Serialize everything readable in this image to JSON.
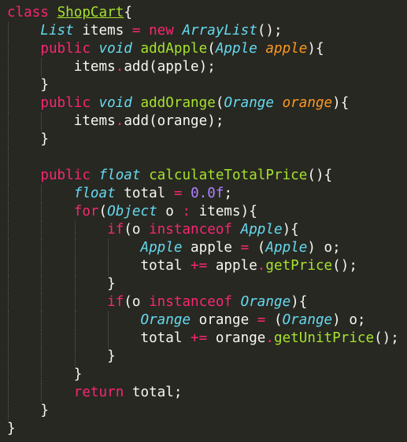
{
  "editor": {
    "background": "#272822",
    "colors": {
      "keyword": "#f92672",
      "type": "#66d9ef",
      "class_name": "#a6e22e",
      "function": "#a6e22e",
      "parameter": "#fd971f",
      "number": "#ae81ff",
      "plain": "#f8f8f2",
      "indent_guide": "#5b5b52"
    },
    "lines": [
      {
        "indent": 0,
        "tokens": [
          {
            "c": "k",
            "t": "class"
          },
          {
            "c": "pl",
            "t": " "
          },
          {
            "c": "cu",
            "t": "ShopCart"
          },
          {
            "c": "pl",
            "t": "{"
          }
        ]
      },
      {
        "indent": 1,
        "tokens": [
          {
            "c": "t",
            "t": "List"
          },
          {
            "c": "pl",
            "t": " items "
          },
          {
            "c": "k",
            "t": "="
          },
          {
            "c": "pl",
            "t": " "
          },
          {
            "c": "k",
            "t": "new"
          },
          {
            "c": "pl",
            "t": " "
          },
          {
            "c": "t",
            "t": "ArrayList"
          },
          {
            "c": "pl",
            "t": "();"
          }
        ]
      },
      {
        "indent": 1,
        "tokens": [
          {
            "c": "k",
            "t": "public"
          },
          {
            "c": "pl",
            "t": " "
          },
          {
            "c": "t",
            "t": "void"
          },
          {
            "c": "pl",
            "t": " "
          },
          {
            "c": "f",
            "t": "addApple"
          },
          {
            "c": "pl",
            "t": "("
          },
          {
            "c": "t",
            "t": "Apple"
          },
          {
            "c": "pl",
            "t": " "
          },
          {
            "c": "p",
            "t": "apple"
          },
          {
            "c": "pl",
            "t": "){"
          }
        ]
      },
      {
        "indent": 2,
        "tokens": [
          {
            "c": "pl",
            "t": "items"
          },
          {
            "c": "k",
            "t": "."
          },
          {
            "c": "pl",
            "t": "add(apple);"
          }
        ]
      },
      {
        "indent": 1,
        "tokens": [
          {
            "c": "pl",
            "t": "}"
          }
        ]
      },
      {
        "indent": 1,
        "tokens": [
          {
            "c": "k",
            "t": "public"
          },
          {
            "c": "pl",
            "t": " "
          },
          {
            "c": "t",
            "t": "void"
          },
          {
            "c": "pl",
            "t": " "
          },
          {
            "c": "f",
            "t": "addOrange"
          },
          {
            "c": "pl",
            "t": "("
          },
          {
            "c": "t",
            "t": "Orange"
          },
          {
            "c": "pl",
            "t": " "
          },
          {
            "c": "p",
            "t": "orange"
          },
          {
            "c": "pl",
            "t": "){"
          }
        ]
      },
      {
        "indent": 2,
        "tokens": [
          {
            "c": "pl",
            "t": "items"
          },
          {
            "c": "k",
            "t": "."
          },
          {
            "c": "pl",
            "t": "add(orange);"
          }
        ]
      },
      {
        "indent": 1,
        "tokens": [
          {
            "c": "pl",
            "t": "}"
          }
        ]
      },
      {
        "indent": 0,
        "tokens": []
      },
      {
        "indent": 1,
        "tokens": [
          {
            "c": "k",
            "t": "public"
          },
          {
            "c": "pl",
            "t": " "
          },
          {
            "c": "t",
            "t": "float"
          },
          {
            "c": "pl",
            "t": " "
          },
          {
            "c": "f",
            "t": "calculateTotalPrice"
          },
          {
            "c": "pl",
            "t": "(){"
          }
        ]
      },
      {
        "indent": 2,
        "tokens": [
          {
            "c": "t",
            "t": "float"
          },
          {
            "c": "pl",
            "t": " total "
          },
          {
            "c": "k",
            "t": "="
          },
          {
            "c": "pl",
            "t": " "
          },
          {
            "c": "n",
            "t": "0.0f"
          },
          {
            "c": "pl",
            "t": ";"
          }
        ]
      },
      {
        "indent": 2,
        "tokens": [
          {
            "c": "k",
            "t": "for"
          },
          {
            "c": "pl",
            "t": "("
          },
          {
            "c": "t",
            "t": "Object"
          },
          {
            "c": "pl",
            "t": " o "
          },
          {
            "c": "k",
            "t": ":"
          },
          {
            "c": "pl",
            "t": " items){"
          }
        ]
      },
      {
        "indent": 3,
        "tokens": [
          {
            "c": "k",
            "t": "if"
          },
          {
            "c": "pl",
            "t": "(o "
          },
          {
            "c": "k",
            "t": "instanceof"
          },
          {
            "c": "pl",
            "t": " "
          },
          {
            "c": "t",
            "t": "Apple"
          },
          {
            "c": "pl",
            "t": "){"
          }
        ]
      },
      {
        "indent": 4,
        "tokens": [
          {
            "c": "t",
            "t": "Apple"
          },
          {
            "c": "pl",
            "t": " apple "
          },
          {
            "c": "k",
            "t": "="
          },
          {
            "c": "pl",
            "t": " ("
          },
          {
            "c": "t",
            "t": "Apple"
          },
          {
            "c": "pl",
            "t": ") o;"
          }
        ]
      },
      {
        "indent": 4,
        "tokens": [
          {
            "c": "pl",
            "t": "total "
          },
          {
            "c": "k",
            "t": "+="
          },
          {
            "c": "pl",
            "t": " apple"
          },
          {
            "c": "k",
            "t": "."
          },
          {
            "c": "f",
            "t": "getPrice"
          },
          {
            "c": "pl",
            "t": "();"
          }
        ]
      },
      {
        "indent": 3,
        "tokens": [
          {
            "c": "pl",
            "t": "}"
          }
        ]
      },
      {
        "indent": 3,
        "tokens": [
          {
            "c": "k",
            "t": "if"
          },
          {
            "c": "pl",
            "t": "(o "
          },
          {
            "c": "k",
            "t": "instanceof"
          },
          {
            "c": "pl",
            "t": " "
          },
          {
            "c": "t",
            "t": "Orange"
          },
          {
            "c": "pl",
            "t": "){"
          }
        ]
      },
      {
        "indent": 4,
        "tokens": [
          {
            "c": "t",
            "t": "Orange"
          },
          {
            "c": "pl",
            "t": " orange "
          },
          {
            "c": "k",
            "t": "="
          },
          {
            "c": "pl",
            "t": " ("
          },
          {
            "c": "t",
            "t": "Orange"
          },
          {
            "c": "pl",
            "t": ") o;"
          }
        ]
      },
      {
        "indent": 4,
        "tokens": [
          {
            "c": "pl",
            "t": "total "
          },
          {
            "c": "k",
            "t": "+="
          },
          {
            "c": "pl",
            "t": " orange"
          },
          {
            "c": "k",
            "t": "."
          },
          {
            "c": "f",
            "t": "getUnitPrice"
          },
          {
            "c": "pl",
            "t": "();"
          }
        ]
      },
      {
        "indent": 3,
        "tokens": [
          {
            "c": "pl",
            "t": "}"
          }
        ]
      },
      {
        "indent": 2,
        "tokens": [
          {
            "c": "pl",
            "t": "}"
          }
        ]
      },
      {
        "indent": 2,
        "tokens": [
          {
            "c": "k",
            "t": "return"
          },
          {
            "c": "pl",
            "t": " total;"
          }
        ]
      },
      {
        "indent": 1,
        "tokens": [
          {
            "c": "pl",
            "t": "}"
          }
        ]
      },
      {
        "indent": 0,
        "tokens": [
          {
            "c": "pl",
            "t": "}"
          }
        ]
      }
    ]
  }
}
